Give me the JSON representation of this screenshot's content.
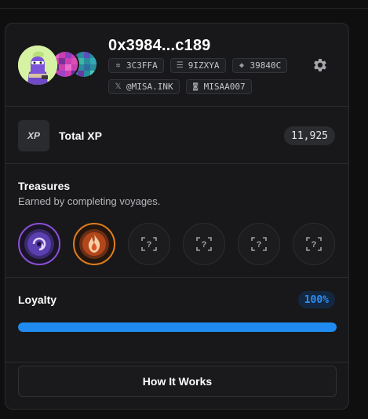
{
  "profile": {
    "title": "0x3984...c189",
    "chips": [
      {
        "icon": "asterisk-icon",
        "glyph": "✲",
        "label": "3C3FFA"
      },
      {
        "icon": "stack-icon",
        "glyph": "☰",
        "label": "9IZXYA"
      },
      {
        "icon": "ethereum-icon",
        "glyph": "◆",
        "label": "39840C"
      },
      {
        "icon": "x-icon",
        "glyph": "𝕏",
        "label": "@MISA.INK"
      },
      {
        "icon": "discord-icon",
        "glyph": "◙",
        "label": "MISAA007"
      }
    ]
  },
  "xp": {
    "logo": "XP",
    "label": "Total XP",
    "value": "11,925"
  },
  "treasures": {
    "title": "Treasures",
    "subtitle": "Earned by completing voyages.",
    "items": [
      {
        "state": "earned",
        "icon": "purple-portal-icon"
      },
      {
        "state": "earned",
        "icon": "flame-icon"
      },
      {
        "state": "locked",
        "icon": "unknown-treasure-icon"
      },
      {
        "state": "locked",
        "icon": "unknown-treasure-icon"
      },
      {
        "state": "locked",
        "icon": "unknown-treasure-icon"
      },
      {
        "state": "locked",
        "icon": "unknown-treasure-icon"
      }
    ]
  },
  "loyalty": {
    "title": "Loyalty",
    "percent_label": "100%",
    "progress": 1.0
  },
  "how_it_works": {
    "label": "How It Works"
  },
  "colors": {
    "accent": "#1f8bf0",
    "card_bg": "#18181a",
    "page_bg": "#0f0f10"
  }
}
